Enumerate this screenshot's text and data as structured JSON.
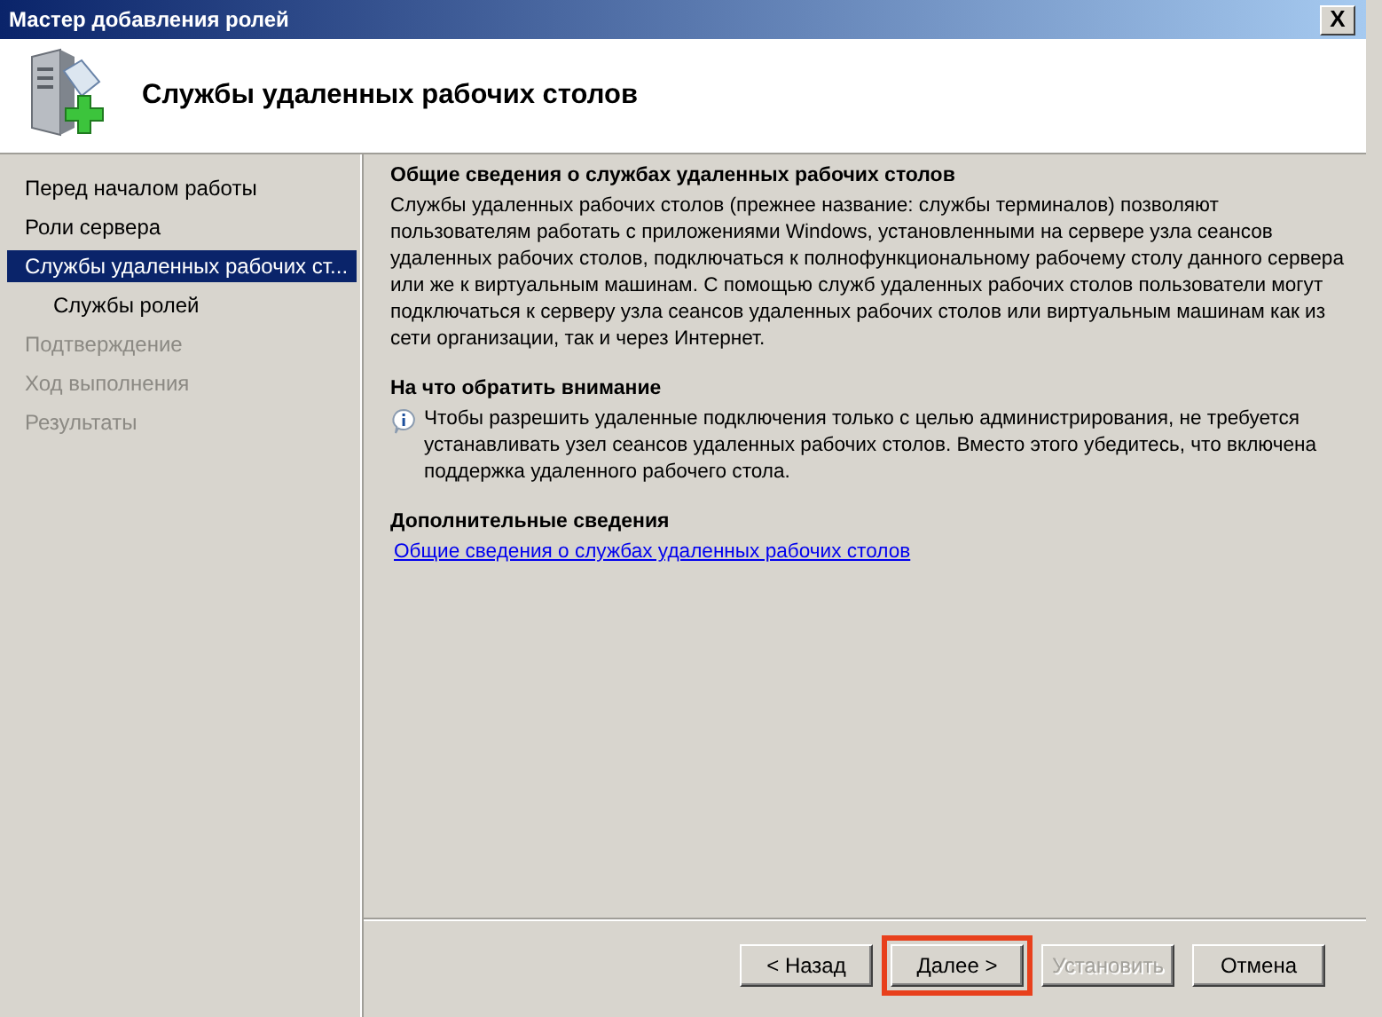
{
  "window": {
    "title": "Мастер добавления ролей",
    "close": "X"
  },
  "header": {
    "title": "Службы удаленных рабочих столов"
  },
  "sidebar": {
    "items": [
      {
        "label": "Перед началом работы",
        "selected": false,
        "disabled": false
      },
      {
        "label": "Роли сервера",
        "selected": false,
        "disabled": false
      },
      {
        "label": "Службы удаленных рабочих ст...",
        "selected": true,
        "disabled": false,
        "children": [
          {
            "label": "Службы ролей",
            "selected": false,
            "disabled": false
          }
        ]
      },
      {
        "label": "Подтверждение",
        "selected": false,
        "disabled": true
      },
      {
        "label": "Ход выполнения",
        "selected": false,
        "disabled": true
      },
      {
        "label": "Результаты",
        "selected": false,
        "disabled": true
      }
    ]
  },
  "content": {
    "sections": [
      {
        "kind": "text",
        "heading": "Общие сведения о службах удаленных рабочих столов",
        "body": "Службы удаленных рабочих столов (прежнее название: службы терминалов) позволяют пользователям работать с приложениями Windows, установленными на сервере узла сеансов удаленных рабочих столов, подключаться к полнофункциональному рабочему столу данного сервера или же к виртуальным машинам. С помощью служб удаленных рабочих столов пользователи могут подключаться к серверу узла сеансов удаленных рабочих столов или виртуальным машинам как из сети организации, так и через Интернет."
      },
      {
        "kind": "note",
        "heading": "На что обратить внимание",
        "body": "Чтобы разрешить удаленные подключения только с целью администрирования, не требуется устанавливать узел сеансов удаленных рабочих столов. Вместо этого убедитесь, что включена поддержка удаленного рабочего стола."
      },
      {
        "kind": "link",
        "heading": "Дополнительные сведения",
        "body": "Общие сведения о службах удаленных рабочих столов"
      }
    ]
  },
  "buttons": [
    {
      "label": "< Назад",
      "disabled": false,
      "highlighted": false
    },
    {
      "label": "Далее >",
      "disabled": false,
      "highlighted": true
    },
    {
      "label": "Установить",
      "disabled": true,
      "highlighted": false
    },
    {
      "label": "Отмена",
      "disabled": false,
      "highlighted": false
    }
  ]
}
